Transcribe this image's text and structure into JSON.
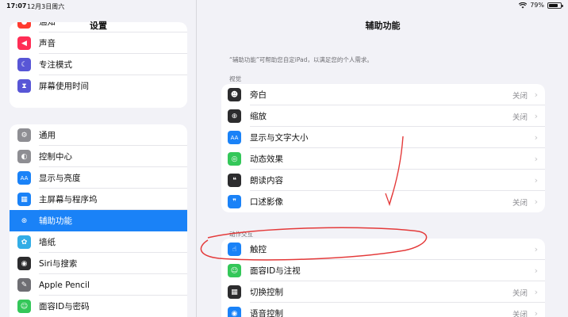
{
  "status_bar": {
    "time": "17:07",
    "date": "12月3日周六",
    "battery": "79%",
    "battery_level": 0.79
  },
  "sidebar": {
    "title": "设置",
    "group1": [
      {
        "label": "通知",
        "icon": "bell-icon",
        "color": "#ff3b30",
        "glyph": "●"
      },
      {
        "label": "声音",
        "icon": "speaker-icon",
        "color": "#ff2d55",
        "glyph": "◀"
      },
      {
        "label": "专注模式",
        "icon": "moon-icon",
        "color": "#5856d6",
        "glyph": "☾"
      },
      {
        "label": "屏幕使用时间",
        "icon": "hourglass-icon",
        "color": "#5856d6",
        "glyph": "⧗"
      }
    ],
    "group2": [
      {
        "label": "通用",
        "icon": "gear-icon",
        "color": "#8e8e93",
        "glyph": "⚙"
      },
      {
        "label": "控制中心",
        "icon": "toggles-icon",
        "color": "#8e8e93",
        "glyph": "◐"
      },
      {
        "label": "显示与亮度",
        "icon": "display-aa-icon",
        "color": "#1a82f7",
        "glyph": "AA"
      },
      {
        "label": "主屏幕与程序坞",
        "icon": "grid-icon",
        "color": "#1a82f7",
        "glyph": "▦"
      },
      {
        "label": "辅助功能",
        "icon": "accessibility-icon",
        "color": "#1a82f7",
        "glyph": "⊛",
        "selected": true
      },
      {
        "label": "墙纸",
        "icon": "wallpaper-icon",
        "color": "#32ade6",
        "glyph": "✿"
      },
      {
        "label": "Siri与搜索",
        "icon": "siri-icon",
        "color": "#2c2c2e",
        "glyph": "◉"
      },
      {
        "label": "Apple Pencil",
        "icon": "pencil-icon",
        "color": "#6e6e73",
        "glyph": "✎"
      },
      {
        "label": "面容ID与密码",
        "icon": "faceid-icon",
        "color": "#34c759",
        "glyph": "☺"
      }
    ]
  },
  "main": {
    "title": "辅助功能",
    "description": "“辅助功能”可帮助您自定iPad，以满足您的个人需求。",
    "vision_header": "视觉",
    "vision_items": [
      {
        "label": "旁白",
        "value": "关闭",
        "icon": "voiceover-icon",
        "color": "#2c2c2e",
        "glyph": "☻"
      },
      {
        "label": "缩放",
        "value": "关闭",
        "icon": "zoom-icon",
        "color": "#2c2c2e",
        "glyph": "⊕"
      },
      {
        "label": "显示与文字大小",
        "value": "",
        "icon": "text-size-icon",
        "color": "#1a82f7",
        "glyph": "AA"
      },
      {
        "label": "动态效果",
        "value": "",
        "icon": "motion-icon",
        "color": "#34c759",
        "glyph": "◎"
      },
      {
        "label": "朗读内容",
        "value": "",
        "icon": "speech-icon",
        "color": "#2c2c2e",
        "glyph": "❝"
      },
      {
        "label": "口述影像",
        "value": "关闭",
        "icon": "audio-description-icon",
        "color": "#1a82f7",
        "glyph": "❞"
      }
    ],
    "motor_header": "动作交互",
    "motor_items": [
      {
        "label": "触控",
        "value": "",
        "icon": "touch-hand-icon",
        "color": "#1a82f7",
        "glyph": "☝"
      },
      {
        "label": "面容ID与注视",
        "value": "",
        "icon": "faceid-attention-icon",
        "color": "#34c759",
        "glyph": "☺"
      },
      {
        "label": "切换控制",
        "value": "关闭",
        "icon": "switch-control-icon",
        "color": "#2c2c2e",
        "glyph": "▦"
      },
      {
        "label": "语音控制",
        "value": "关闭",
        "icon": "voice-control-icon",
        "color": "#1a82f7",
        "glyph": "◉"
      }
    ]
  }
}
